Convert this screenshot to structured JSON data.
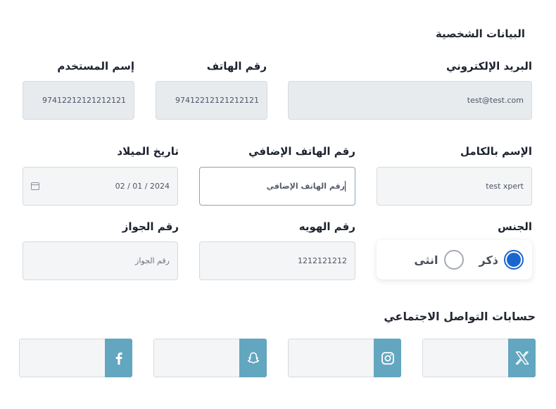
{
  "section_personal": "البيانات الشخصية",
  "labels": {
    "username": "إسم المستخدم",
    "phone": "رقم الهاتف",
    "email": "البريد الإلكتروني",
    "birthdate": "تاريخ الميلاد",
    "extra_phone": "رقم الهاتف الإضافي",
    "full_name": "الإسم بالكامل",
    "passport": "رقم الجواز",
    "id_number": "رقم الهويه",
    "gender": "الجنس"
  },
  "values": {
    "username": "97412212121212121",
    "phone": "97412212121212121",
    "email": "test@test.com",
    "birthdate": "02 / 01 / 2024",
    "full_name": "test xpert",
    "id_number": "1212121212"
  },
  "placeholders": {
    "extra_phone": "رقم الهاتف الإضافي",
    "passport": "رقم الجواز"
  },
  "gender": {
    "male": "ذكر",
    "female": "انثى",
    "selected": "male"
  },
  "section_social": "حسابات التواصل الاجتماعي",
  "social": [
    {
      "name": "facebook",
      "glyph": "f"
    },
    {
      "name": "snapchat",
      "glyph": "ghost"
    },
    {
      "name": "instagram",
      "glyph": "camera"
    },
    {
      "name": "x",
      "glyph": "X"
    }
  ],
  "colors": {
    "accent": "#63a6c0",
    "radio": "#1a66cf",
    "disabled_bg": "#e8ebee"
  }
}
